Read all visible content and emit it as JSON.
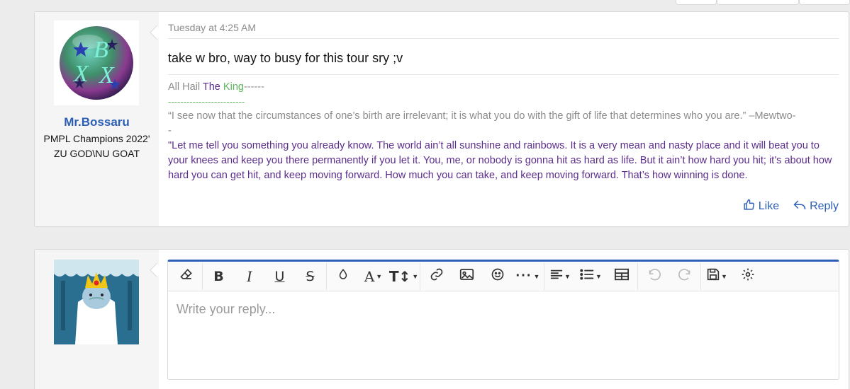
{
  "post1": {
    "username": "Mr.Bossaru",
    "user_title": "PMPL Champions 2022' ZU GOD\\NU GOAT",
    "avatar_letters": "BXX",
    "date": "Tuesday at 4:25 AM",
    "message": "take w bro, way to busy for this tour sry ;v",
    "signature": {
      "hail_prefix": "All Hail ",
      "hail_the": "The",
      "hail_king": "King",
      "hail_dashes": "------",
      "dash_line": "-------------------------",
      "quote1": "“I see now that the circumstances of one’s birth are irrelevant; it is what you do with the gift of life that determines who you are.” –Mewtwo-",
      "quote1_tail": "-",
      "quote2": "\"Let me tell you something you already know. The world ain’t all sunshine and rainbows. It is a very mean and nasty place and it will beat you to your knees and keep you there permanently if you let it. You, me, or nobody is gonna hit as hard as life. But it ain’t how hard you hit; it’s about how hard you can get hit, and keep moving forward. How much you can take, and keep moving forward. That’s how winning is done."
    },
    "actions": {
      "like": "Like",
      "reply": "Reply"
    }
  },
  "editor": {
    "placeholder": "Write your reply..."
  },
  "colors": {
    "accent": "#2d5fb8",
    "purple": "#5b2d8c",
    "green": "#5cb85c"
  },
  "icons": [
    "eraser-icon",
    "bold-icon",
    "italic-icon",
    "underline-icon",
    "strikethrough-icon",
    "text-color-icon",
    "font-family-icon",
    "font-size-icon",
    "link-icon",
    "image-icon",
    "emoji-icon",
    "more-icon",
    "align-icon",
    "list-icon",
    "table-icon",
    "undo-icon",
    "redo-icon",
    "save-draft-icon",
    "settings-icon",
    "like-icon",
    "reply-icon"
  ]
}
